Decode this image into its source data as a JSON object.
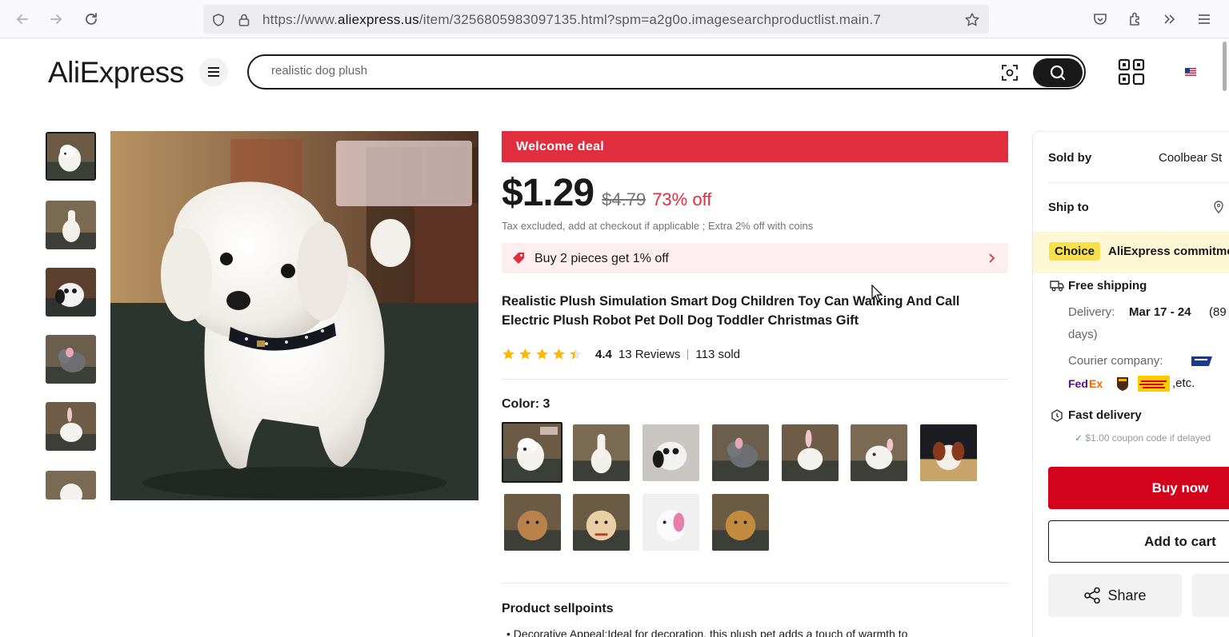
{
  "browser": {
    "url_prefix": "https://www.",
    "url_domain": "aliexpress.us",
    "url_rest": "/item/3256805983097135.html?spm=a2g0o.imagesearchproductlist.main.7"
  },
  "header": {
    "logo": "AliExpress",
    "search": {
      "value": "realistic dog plush"
    }
  },
  "product": {
    "welcome_banner": "Welcome deal",
    "price": "$1.29",
    "original_price": "$4.79",
    "discount": "73% off",
    "tax_note": "Tax excluded, add at checkout if applicable ; Extra 2% off with coins",
    "promo": "Buy 2 pieces get 1% off",
    "title": "Realistic Plush Simulation Smart Dog Children Toy Can Walking And Call Electric Plush Robot Pet Doll Dog Toddler Christmas Gift",
    "rating": 4.4,
    "rating_text": "4.4",
    "reviews": "13 Reviews",
    "sold": "113 sold",
    "color_label": "Color: 3",
    "sellpoints_title": "Product sellpoints",
    "sellpoint_1": "Decorative Appeal:Ideal for decoration, this plush pet adds a touch of warmth to"
  },
  "panel": {
    "sold_by_label": "Sold by",
    "sold_by_value": "Coolbear St",
    "ship_to_label": "Ship to",
    "choice_badge": "Choice",
    "choice_text": "AliExpress commitment",
    "free_shipping": "Free shipping",
    "delivery_label": "Delivery:",
    "delivery_value": "Mar 17 - 24",
    "delivery_suffix": "(89",
    "delivery_line2": "days)",
    "courier_label": "Courier company:",
    "courier_etc": ",etc.",
    "fast_delivery": "Fast delivery",
    "coupon_note": "$1.00 coupon code if delayed",
    "buy_now": "Buy now",
    "add_to_cart": "Add to cart",
    "share": "Share"
  },
  "colors": {
    "accent_red": "#e02e3e",
    "buy_red": "#d3031c",
    "choice_yellow": "#f8e04a",
    "star": "#fdb900"
  }
}
